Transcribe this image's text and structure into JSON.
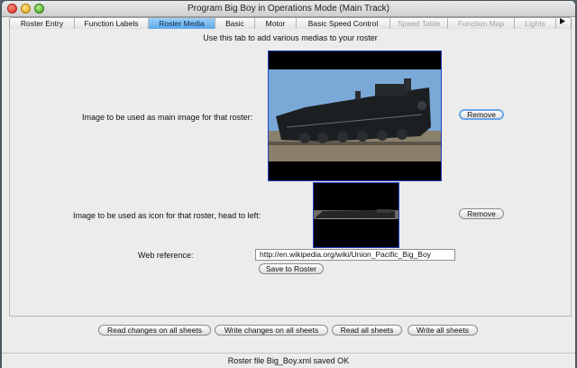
{
  "window": {
    "title": "Program Big Boy in Operations Mode (Main Track)"
  },
  "tabs": [
    {
      "label": "Roster Entry",
      "state": "normal"
    },
    {
      "label": "Function Labels",
      "state": "normal"
    },
    {
      "label": "Roster Media",
      "state": "selected"
    },
    {
      "label": "Basic",
      "state": "normal"
    },
    {
      "label": "Motor",
      "state": "normal"
    },
    {
      "label": "Basic Speed Control",
      "state": "normal"
    },
    {
      "label": "Speed Table",
      "state": "disabled"
    },
    {
      "label": "Function Map",
      "state": "disabled"
    },
    {
      "label": "Lights",
      "state": "disabled"
    }
  ],
  "tab_overflow_icon": "triangle-right",
  "media": {
    "instruction": "Use this tab to add various medias to your roster",
    "main_image_label": "Image to be used as main image for that roster:",
    "main_remove": "Remove",
    "icon_label": "Image to be used as icon for that roster, head to left:",
    "icon_remove": "Remove",
    "web_reference_label": "Web reference:",
    "web_reference_value": "http://en.wikipedia.org/wiki/Union_Pacific_Big_Boy",
    "save_button": "Save to Roster"
  },
  "bottom_buttons": {
    "read_changes": "Read changes on all sheets",
    "write_changes": "Write changes on all sheets",
    "read_all": "Read all sheets",
    "write_all": "Write all sheets"
  },
  "status": "Roster file Big_Boy.xml saved OK",
  "colors": {
    "selected_tab": "#5aa9ec",
    "image_border": "#2040c0",
    "focus_ring": "#6aa7e6"
  }
}
